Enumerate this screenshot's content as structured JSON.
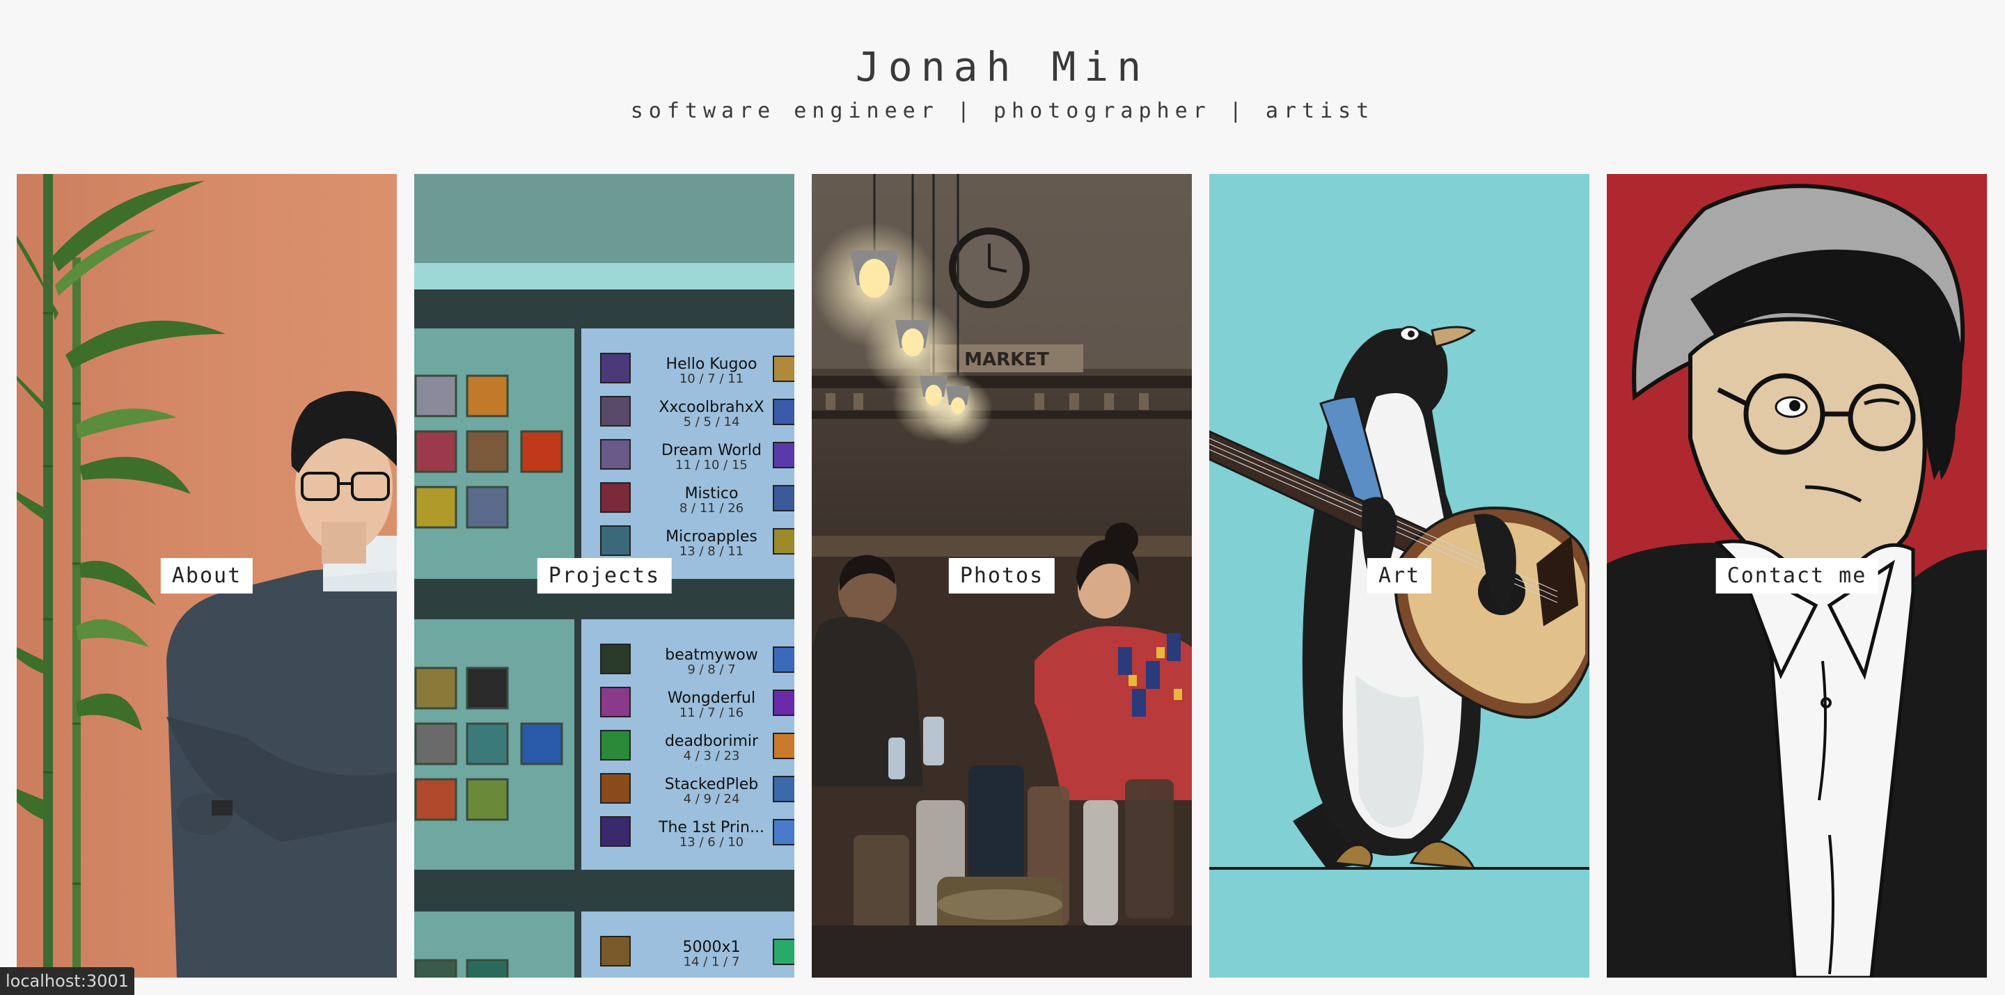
{
  "header": {
    "title": "Jonah Min",
    "subtitle": "software engineer | photographer | artist"
  },
  "panels": [
    {
      "label": "About",
      "image": "portrait-photo",
      "bg": "#d98c68"
    },
    {
      "label": "Projects",
      "image": "app-screenshot",
      "bg": "#6e9a96"
    },
    {
      "label": "Photos",
      "image": "cafe-photo",
      "bg": "#3a2f28"
    },
    {
      "label": "Art",
      "image": "penguin-illustration",
      "bg": "#80d0d4"
    },
    {
      "label": "Contact me",
      "image": "self-portrait-illustration",
      "bg": "#b0282f"
    }
  ],
  "projects_preview": {
    "group1": [
      {
        "name": "Hello Kugoo",
        "kda": "10 / 7 / 11"
      },
      {
        "name": "XxcoolbrahxX",
        "kda": "5 / 5 / 14"
      },
      {
        "name": "Dream World",
        "kda": "11 / 10 / 15"
      },
      {
        "name": "Mistico",
        "kda": "8 / 11 / 26"
      },
      {
        "name": "Microapples",
        "kda": "13 / 8 / 11"
      }
    ],
    "group2": [
      {
        "name": "beatmywow",
        "kda": "9 / 8 / 7"
      },
      {
        "name": "Wongderful",
        "kda": "11 / 7 / 16"
      },
      {
        "name": "deadborimir",
        "kda": "4 / 3 / 23"
      },
      {
        "name": "StackedPleb",
        "kda": "4 / 9 / 24"
      },
      {
        "name": "The 1st Prin...",
        "kda": "13 / 6 / 10"
      }
    ],
    "group3": [
      {
        "name": "5000x1",
        "kda": "14 / 1 / 7"
      }
    ]
  },
  "status_bar": {
    "url": "localhost:3001"
  }
}
